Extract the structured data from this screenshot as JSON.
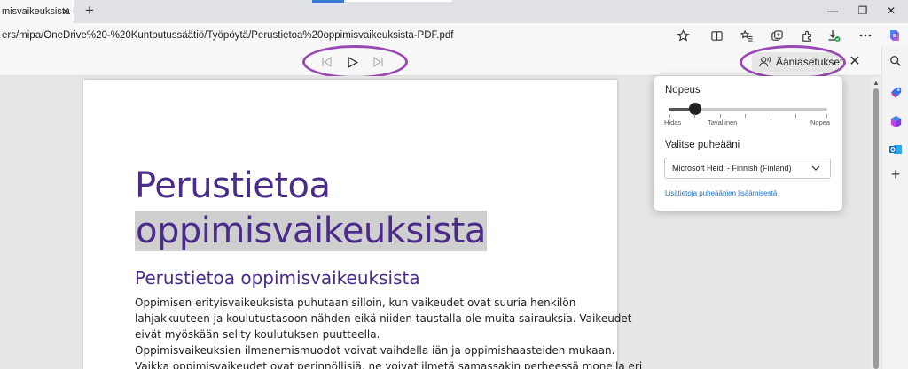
{
  "tab": {
    "title": "misvaikeuksista - PDF",
    "close": "✕",
    "new_tab": "+"
  },
  "window_controls": {
    "minimize": "—",
    "restore": "❐",
    "close": "✕"
  },
  "address": {
    "url": "ers/mipa/OneDrive%20-%20Kuntoutussäätiö/Työpöytä/Perustietoa%20oppimisvaikeuksista-PDF.pdf"
  },
  "toolbar_icons": [
    "star-icon",
    "split-screen-icon",
    "favorites-icon",
    "collections-icon",
    "extensions-icon",
    "downloads-icon",
    "performance-icon",
    "more-icon",
    "copilot-icon"
  ],
  "sidebar_icons": [
    "search-icon",
    "shopping-tag-icon",
    "microsoft365-icon",
    "outlook-icon",
    "add-icon"
  ],
  "pdf_toolbar": {
    "voice_settings_label": "Ääniasetukset",
    "close": "✕"
  },
  "document": {
    "title_line1": "Perustietoa",
    "title_line2": "oppimisvaikeuksista",
    "heading": "Perustietoa oppimisvaikeuksista",
    "paragraph1": [
      "Oppimisen erityisvaikeuksista puhutaan silloin, kun vaikeudet ovat suuria henkilön",
      "lahjakkuuteen ja koulutustasoon nähden eikä niiden taustalla ole muita sairauksia. Vaikeudet",
      "eivät myöskään selity koulutuksen puutteella."
    ],
    "paragraph2": [
      "Oppimisvaikeuksien ilmenemismuodot voivat vaihdella iän ja oppimishaasteiden mukaan.",
      "Vaikka oppimisvaikeudet ovat perinnöllisiä, ne voivat ilmetä samassakin perheessä monella eri"
    ]
  },
  "voice_popup": {
    "speed_label": "Nopeus",
    "speed_value": 0.17,
    "speed_ticks": [
      "Hidas",
      "Tavallinen",
      "Nopea"
    ],
    "voice_label": "Valitse puheääni",
    "voice_selected": "Microsoft Heidi - Finnish (Finland)",
    "more_voices_link": "Lisätietoja puheäänien lisäämisestä"
  },
  "colors": {
    "heading": "#4a2b8a",
    "annotation": "#9a49b4",
    "link": "#1a6ed1",
    "highlight": "#cfcfcf"
  }
}
